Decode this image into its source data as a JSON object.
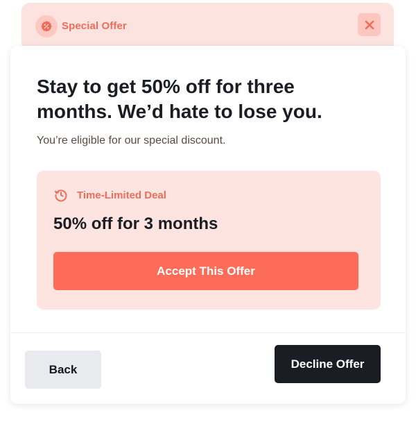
{
  "header": {
    "title": "Special Offer",
    "badge_icon": "percent-badge-icon",
    "close_icon": "close-icon"
  },
  "card": {
    "headline": "Stay to get 50% off for three months. We’d hate to lose you.",
    "subtext": "You’re eligible for our special discount."
  },
  "deal": {
    "label": "Time-Limited Deal",
    "icon": "timer-icon",
    "title": "50% off for 3 months",
    "accept_label": "Accept This Offer"
  },
  "footer": {
    "back_label": "Back",
    "decline_label": "Decline Offer"
  },
  "colors": {
    "accent": "#fd6c58",
    "accent_text": "#ec6e5a",
    "header_bg": "#fde3df",
    "panel_bg": "#fde4e0",
    "dark_button": "#1a1d24",
    "light_button": "#e9eaed"
  }
}
